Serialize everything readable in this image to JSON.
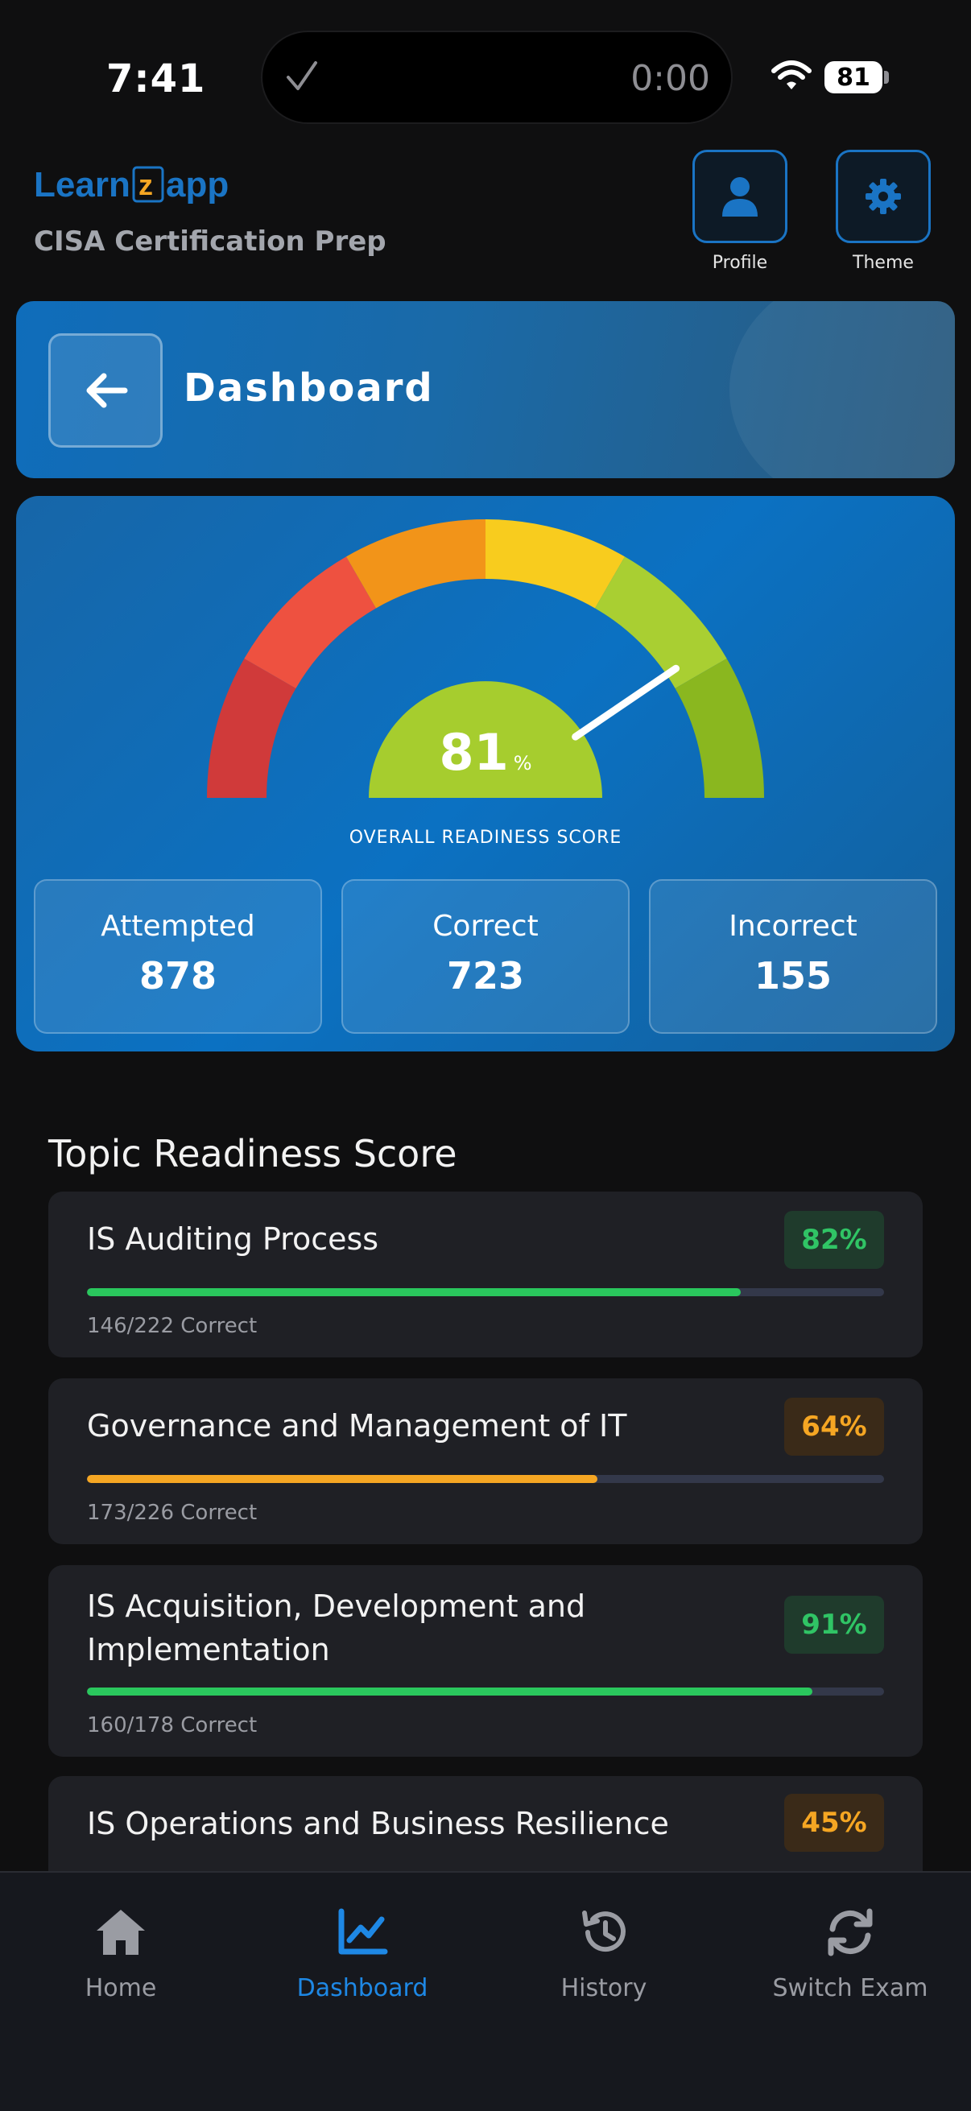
{
  "status_bar": {
    "time": "7:41",
    "timer": "0:00",
    "battery": "81"
  },
  "header": {
    "logo_text": "LearnZapp",
    "subtitle": "CISA Certification Prep",
    "profile_label": "Profile",
    "theme_label": "Theme"
  },
  "banner": {
    "title": "Dashboard"
  },
  "score": {
    "value": "81",
    "unit": "%",
    "percent": 81,
    "caption": "OVERALL READINESS SCORE"
  },
  "stats": [
    {
      "label": "Attempted",
      "value": "878"
    },
    {
      "label": "Correct",
      "value": "723"
    },
    {
      "label": "Incorrect",
      "value": "155"
    }
  ],
  "topics_title": "Topic Readiness Score",
  "topics": [
    {
      "name": "IS Auditing Process",
      "percent_label": "82%",
      "percent": 82,
      "count": "146/222 Correct",
      "status_color": "#2ac75d"
    },
    {
      "name": "Governance and Management of IT",
      "percent_label": "64%",
      "percent": 64,
      "count": "173/226 Correct",
      "status_color": "#f5a623"
    },
    {
      "name": "IS Acquisition, Development and Implementation",
      "percent_label": "91%",
      "percent": 91,
      "count": "160/178 Correct",
      "status_color": "#2ac75d"
    },
    {
      "name": "IS Operations and Business Resilience",
      "percent_label": "45%",
      "percent": 45,
      "count": "",
      "status_color": "#f5a623"
    }
  ],
  "nav": [
    {
      "label": "Home",
      "icon": "home-icon",
      "active": false
    },
    {
      "label": "Dashboard",
      "icon": "chart-line-icon",
      "active": true
    },
    {
      "label": "History",
      "icon": "history-icon",
      "active": false
    },
    {
      "label": "Switch Exam",
      "icon": "refresh-icon",
      "active": false
    }
  ],
  "colors": {
    "accent": "#1e88e5",
    "background": "#0f0f10",
    "card": "#1f2025",
    "good": "#2ac75d",
    "warn": "#f5a623",
    "gauge_center": "#a6cd2e"
  }
}
